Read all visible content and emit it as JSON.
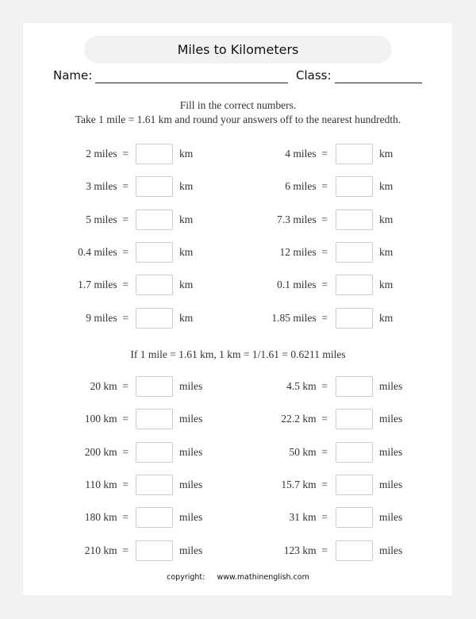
{
  "title": "Miles to Kilometers",
  "name_label": "Name:",
  "class_label": "Class:",
  "instructions": {
    "line1": "Fill in the correct numbers.",
    "line2": "Take 1 mile = 1.61 km and round your answers off to the nearest hundredth."
  },
  "section1": {
    "unit": "km",
    "left": [
      "2 miles  =",
      "3 miles  =",
      "5 miles  =",
      "0.4 miles  =",
      "1.7 miles  =",
      "9 miles  ="
    ],
    "right": [
      "4 miles  =",
      "6 miles  =",
      "7.3 miles  =",
      "12 miles  =",
      "0.1 miles  =",
      "1.85 miles  ="
    ]
  },
  "section2_note": "If 1 mile = 1.61 km, 1 km = 1/1.61 =  0.6211 miles",
  "section2": {
    "unit": "miles",
    "left": [
      "20 km  =",
      "100 km  =",
      "200 km  =",
      "110 km  =",
      "180 km  =",
      "210 km  ="
    ],
    "right": [
      "4.5 km  =",
      "22.2 km  =",
      "50 km  =",
      "15.7 km  =",
      "31 km  =",
      "123 km  ="
    ]
  },
  "footer": {
    "copyright_label": "copyright:",
    "website": "www.mathinenglish.com"
  }
}
